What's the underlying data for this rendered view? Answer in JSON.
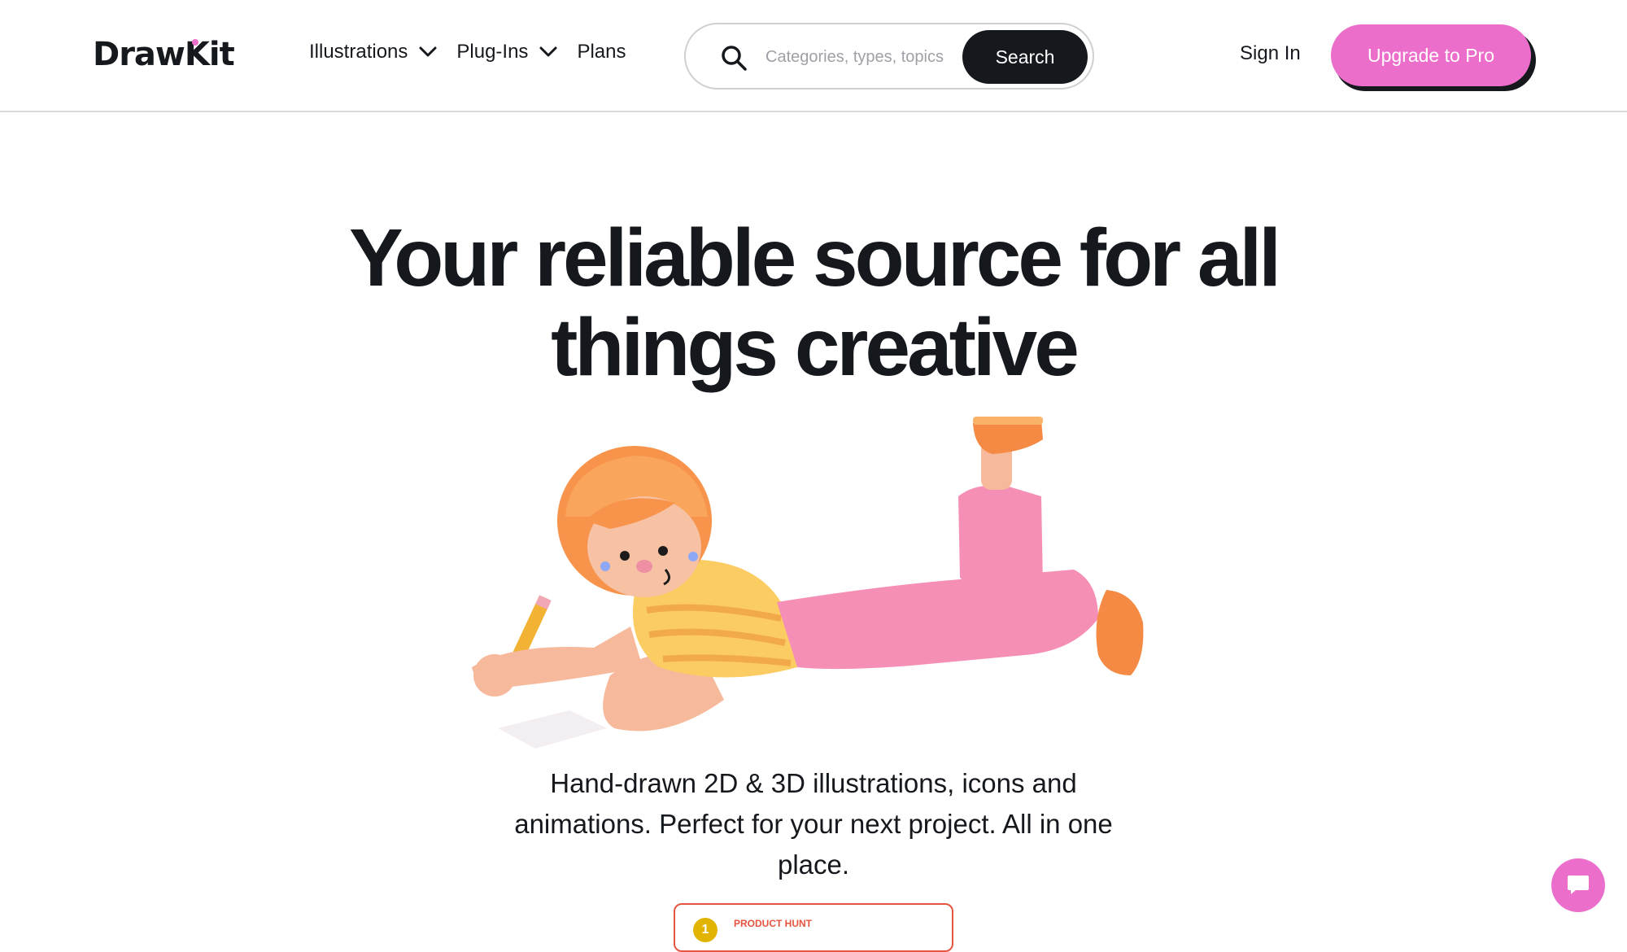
{
  "header": {
    "logo": "DrawKit",
    "nav": [
      {
        "label": "Illustrations",
        "has_dropdown": true
      },
      {
        "label": "Plug-Ins",
        "has_dropdown": true
      },
      {
        "label": "Plans",
        "has_dropdown": false
      }
    ],
    "search": {
      "placeholder": "Categories, types, topics",
      "value": "",
      "button_label": "Search",
      "icon": "search-icon"
    },
    "sign_in_label": "Sign In",
    "upgrade_label": "Upgrade to Pro"
  },
  "hero": {
    "title_line1": "Your reliable source for all",
    "title_line2": "things creative",
    "subtitle": "Hand-drawn 2D & 3D illustrations, icons and animations. Perfect for your next project. All in one place.",
    "badge": {
      "rank": "1",
      "label": "PRODUCT HUNT"
    }
  },
  "chat": {
    "icon": "chat-bubble-icon"
  },
  "colors": {
    "accent_pink": "#ec6ecb",
    "dark": "#15181d",
    "badge_red": "#e5543f"
  }
}
